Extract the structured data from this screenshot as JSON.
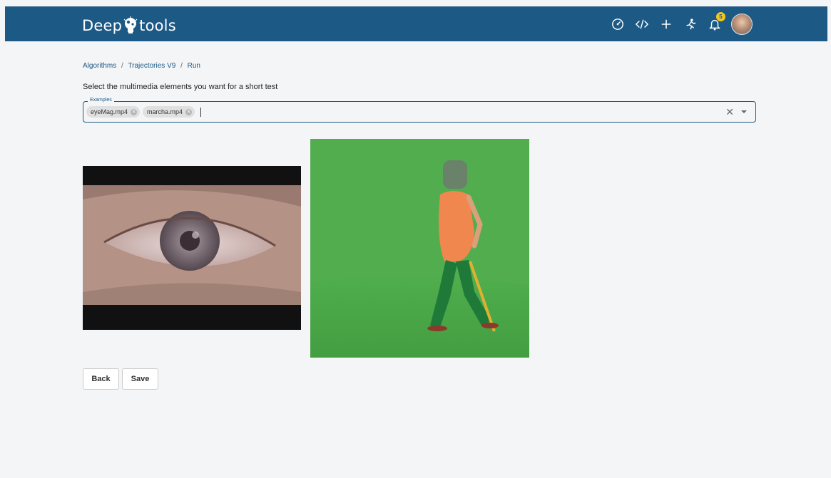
{
  "header": {
    "logo_left": "Deep",
    "logo_right": "tools",
    "notification_count": "5",
    "icons": [
      "dashboard-icon",
      "code-icon",
      "plus-icon",
      "run-icon",
      "bell-icon",
      "avatar"
    ],
    "bg_color": "#1d5985",
    "badge_color": "#f5c518"
  },
  "breadcrumb": {
    "items": [
      "Algorithms",
      "Trajectories V9",
      "Run"
    ],
    "separator": "/"
  },
  "form": {
    "instruction": "Select the multimedia elements you want for a short test",
    "select_label": "Examples",
    "chips": [
      "eyeMag.mp4",
      "marcha.mp4"
    ],
    "clear_symbol": "✕"
  },
  "media": [
    {
      "name": "eyeMag.mp4",
      "kind": "video"
    },
    {
      "name": "marcha.mp4",
      "kind": "video"
    }
  ],
  "actions": {
    "back_label": "Back",
    "save_label": "Save"
  }
}
